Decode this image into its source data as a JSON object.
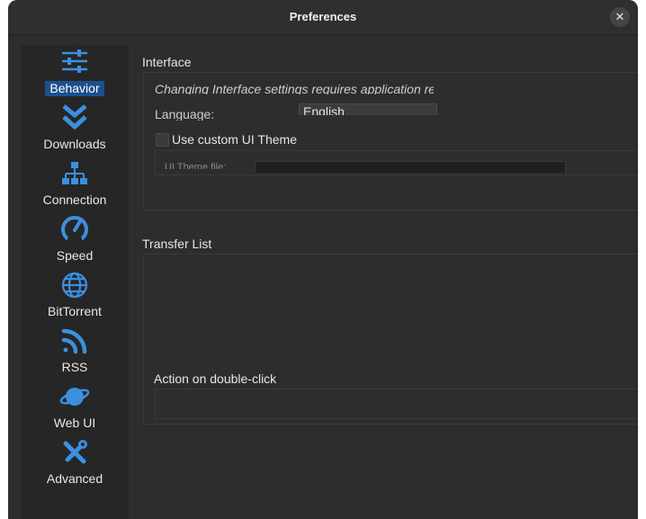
{
  "window": {
    "title": "Preferences"
  },
  "sidebar": {
    "items": [
      {
        "label": "Behavior",
        "icon": "sliders-icon",
        "selected": true
      },
      {
        "label": "Downloads",
        "icon": "double-chevron-down-icon"
      },
      {
        "label": "Connection",
        "icon": "network-tree-icon"
      },
      {
        "label": "Speed",
        "icon": "speedometer-icon"
      },
      {
        "label": "BitTorrent",
        "icon": "globe-icon"
      },
      {
        "label": "RSS",
        "icon": "rss-icon"
      },
      {
        "label": "Web UI",
        "icon": "planet-icon"
      },
      {
        "label": "Advanced",
        "icon": "tools-icon"
      }
    ]
  },
  "interface": {
    "title": "Interface",
    "restart_note": "Changing Interface settings requires application restart",
    "language_label": "Language:",
    "language_value": "English",
    "custom_theme_label": "Use custom UI Theme",
    "theme_path_label": "UI Theme file:"
  },
  "transfer_list": {
    "title": "Transfer List",
    "double_click_title": "Action on double-click"
  },
  "colors": {
    "accent": "#3d8fe0",
    "selection": "#1c4f8e"
  }
}
